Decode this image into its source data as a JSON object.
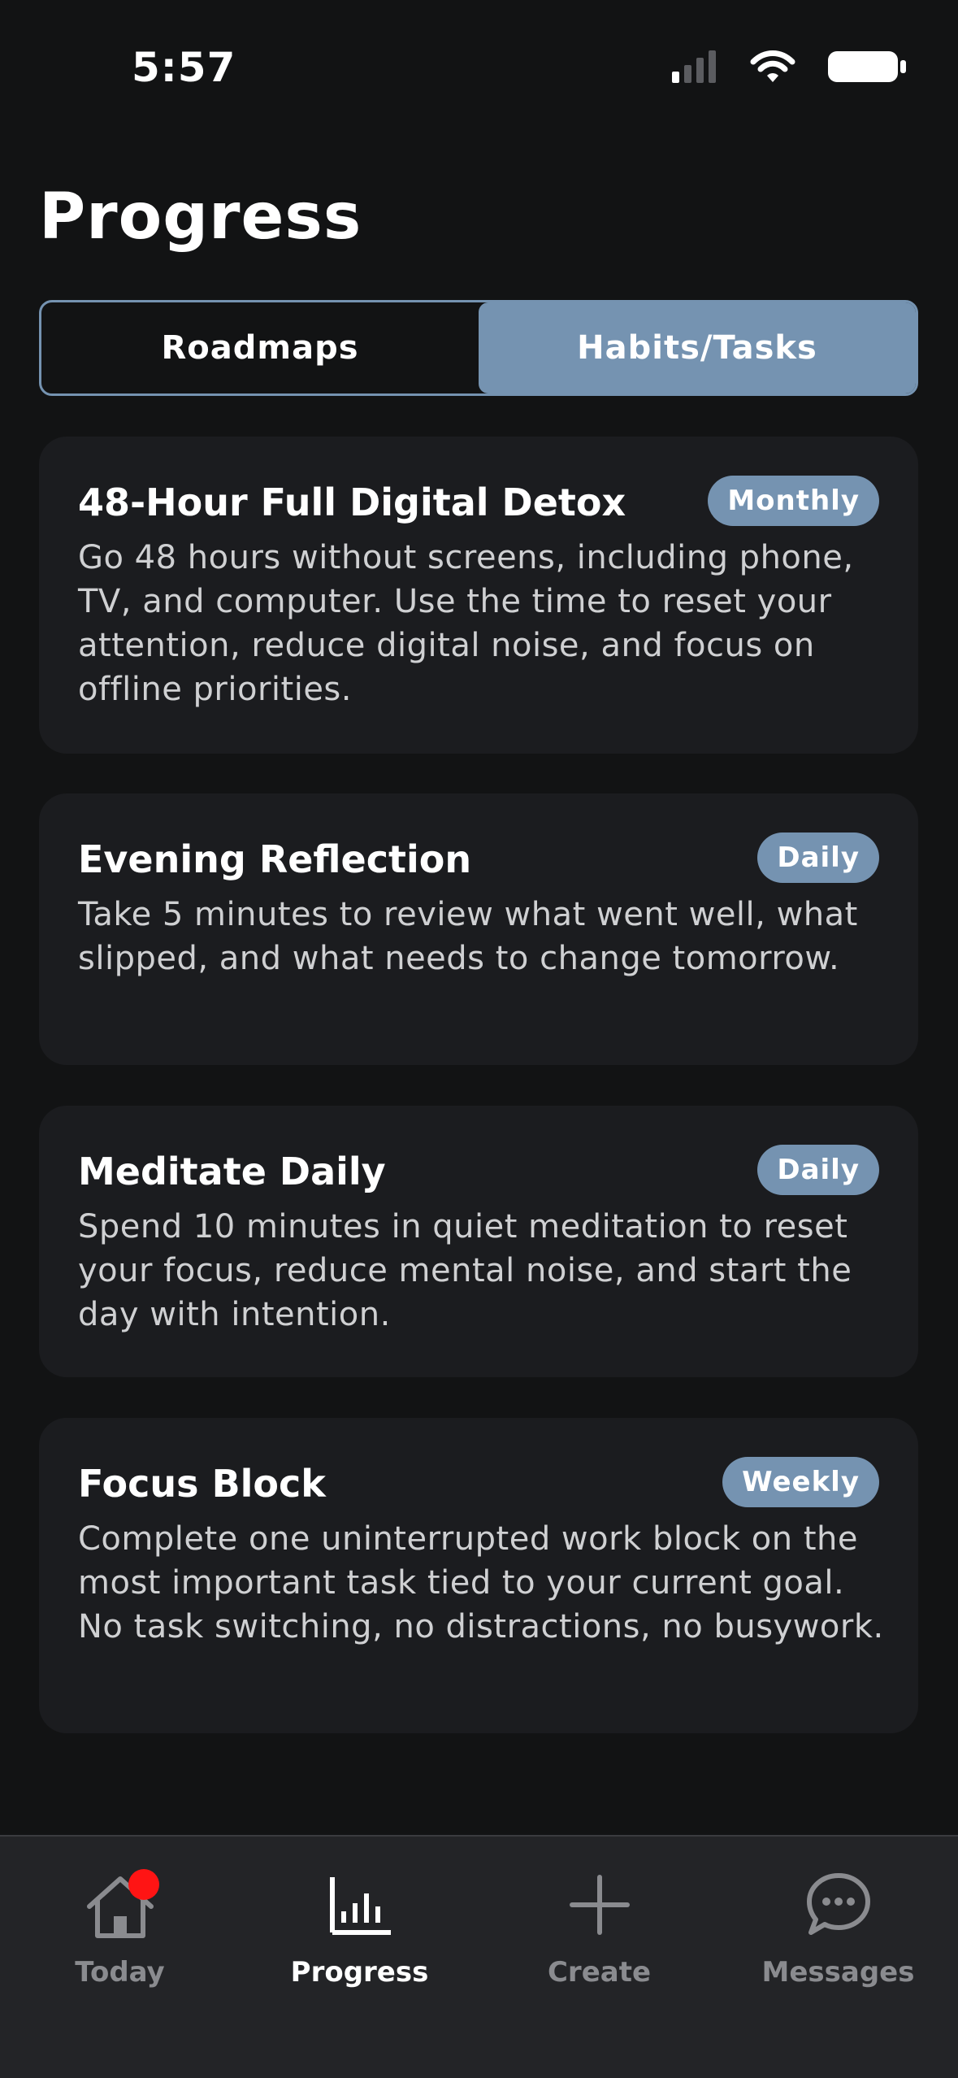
{
  "status": {
    "time": "5:57"
  },
  "page": {
    "title": "Progress"
  },
  "tabs": [
    {
      "label": "Roadmaps",
      "active": false
    },
    {
      "label": "Habits/Tasks",
      "active": true
    }
  ],
  "cards": [
    {
      "title": "48-Hour Full Digital Detox",
      "frequency": "Monthly",
      "description": "Go 48 hours without screens, including phone, TV, and computer. Use the time to reset your attention, reduce digital noise, and focus on offline priorities."
    },
    {
      "title": "Evening Reflection",
      "frequency": "Daily",
      "description": "Take 5 minutes to review what went well, what slipped, and what needs to change tomorrow."
    },
    {
      "title": "Meditate Daily",
      "frequency": "Daily",
      "description": "Spend 10 minutes in quiet meditation to reset your focus, reduce mental noise, and start the day with intention."
    },
    {
      "title": "Focus Block",
      "frequency": "Weekly",
      "description": "Complete one uninterrupted work block on the most important task tied to your current goal. No task switching, no distractions, no busywork."
    }
  ],
  "nav": [
    {
      "label": "Today",
      "icon": "home-icon",
      "active": false,
      "has_notification": true
    },
    {
      "label": "Progress",
      "icon": "bar-chart-icon",
      "active": true
    },
    {
      "label": "Create",
      "icon": "plus-icon",
      "active": false
    },
    {
      "label": "Messages",
      "icon": "chat-bubble-icon",
      "active": false
    }
  ],
  "colors": {
    "background": "#121314",
    "card": "#1b1c1f",
    "accent": "#7593b1",
    "nav_background": "#232427",
    "notification": "#ff1414"
  }
}
